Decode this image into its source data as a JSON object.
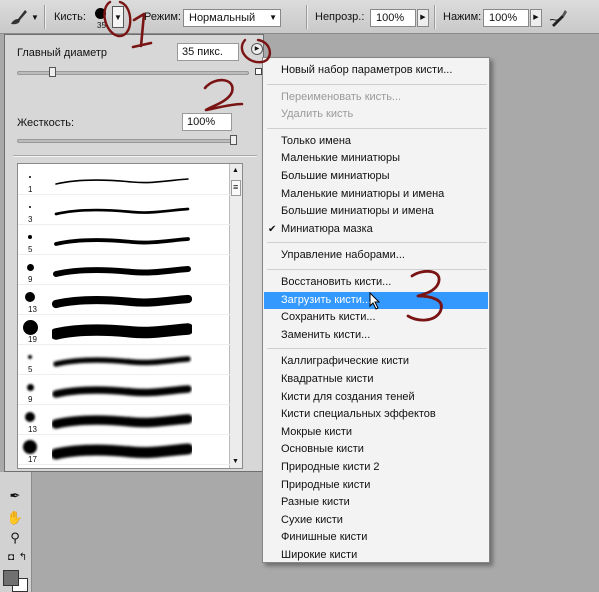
{
  "options_bar": {
    "tool_icon": "brush-tool-icon",
    "brush_label": "Кисть:",
    "brush_size": "35",
    "mode_label": "Режим:",
    "mode_value": "Нормальный",
    "opacity_label": "Непрозр.:",
    "opacity_value": "100%",
    "flow_label": "Нажим:",
    "flow_value": "100%",
    "airbrush_icon": "airbrush-icon"
  },
  "brush_panel": {
    "diameter_label": "Главный диаметр",
    "diameter_value": "35 пикс.",
    "diameter_level_percent": 15,
    "hardness_label": "Жесткость:",
    "hardness_value": "100%",
    "hardness_level_percent": 100,
    "presets": [
      {
        "size": "1",
        "kind": "hard"
      },
      {
        "size": "3",
        "kind": "hard"
      },
      {
        "size": "5",
        "kind": "hard"
      },
      {
        "size": "9",
        "kind": "hard"
      },
      {
        "size": "13",
        "kind": "hard"
      },
      {
        "size": "19",
        "kind": "hard"
      },
      {
        "size": "5",
        "kind": "soft"
      },
      {
        "size": "9",
        "kind": "soft"
      },
      {
        "size": "13",
        "kind": "soft"
      },
      {
        "size": "17",
        "kind": "soft"
      }
    ]
  },
  "menu": {
    "items": [
      {
        "label": "Новый набор параметров кисти...",
        "enabled": true
      },
      {
        "sep": true
      },
      {
        "label": "Переименовать кисть...",
        "enabled": false
      },
      {
        "label": "Удалить кисть",
        "enabled": false
      },
      {
        "sep": true
      },
      {
        "label": "Только имена",
        "enabled": true
      },
      {
        "label": "Маленькие миниатюры",
        "enabled": true
      },
      {
        "label": "Большие миниатюры",
        "enabled": true
      },
      {
        "label": "Маленькие миниатюры и имена",
        "enabled": true
      },
      {
        "label": "Большие миниатюры и имена",
        "enabled": true
      },
      {
        "label": "Миниатюра мазка",
        "enabled": true,
        "checked": true
      },
      {
        "sep": true
      },
      {
        "label": "Управление наборами...",
        "enabled": true
      },
      {
        "sep": true
      },
      {
        "label": "Восстановить кисти...",
        "enabled": true
      },
      {
        "label": "Загрузить кисти...",
        "enabled": true,
        "highlighted": true
      },
      {
        "label": "Сохранить кисти...",
        "enabled": true
      },
      {
        "label": "Заменить кисти...",
        "enabled": true
      },
      {
        "sep": true
      },
      {
        "label": "Каллиграфические кисти",
        "enabled": true
      },
      {
        "label": "Квадратные кисти",
        "enabled": true
      },
      {
        "label": "Кисти для создания теней",
        "enabled": true
      },
      {
        "label": "Кисти специальных эффектов",
        "enabled": true
      },
      {
        "label": "Мокрые кисти",
        "enabled": true
      },
      {
        "label": "Основные кисти",
        "enabled": true
      },
      {
        "label": "Природные кисти 2",
        "enabled": true
      },
      {
        "label": "Природные кисти",
        "enabled": true
      },
      {
        "label": "Разные кисти",
        "enabled": true
      },
      {
        "label": "Сухие кисти",
        "enabled": true
      },
      {
        "label": "Финишные кисти",
        "enabled": true
      },
      {
        "label": "Широкие кисти",
        "enabled": true
      }
    ]
  },
  "annotations": {
    "color": "#7a1414",
    "marks": [
      "1",
      "2",
      "3"
    ]
  },
  "colors": {
    "highlight": "#3399ff",
    "foreground_swatch": "#707070",
    "background_swatch": "#ffffff"
  }
}
